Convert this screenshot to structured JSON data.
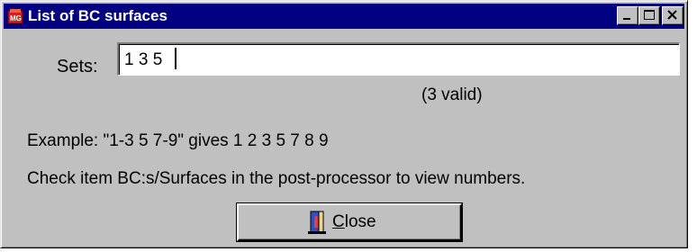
{
  "window": {
    "title": "List of BC surfaces",
    "titlebar_color": "#000080",
    "face_color": "#c0c0c0",
    "controls": {
      "minimize": "minimize-icon",
      "maximize": "maximize-icon",
      "close": "close-icon"
    }
  },
  "form": {
    "sets_label": "Sets:",
    "sets_value": "1 3 5",
    "valid_status": "(3 valid)",
    "example": "Example: \"1-3 5 7-9\" gives 1 2 3 5 7 8 9",
    "hint": "Check item BC:s/Surfaces in the post-processor to view numbers."
  },
  "buttons": {
    "close_mnemonic": "C",
    "close_rest": "lose",
    "close_icon": "door-exit-icon"
  }
}
